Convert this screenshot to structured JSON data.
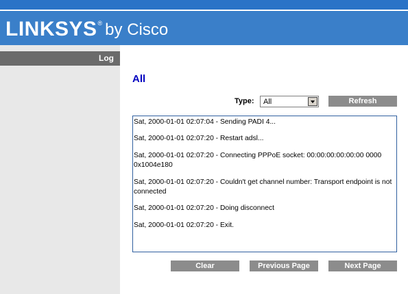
{
  "header": {
    "brand": "LINKSYS",
    "registered": "®",
    "suffix": "by Cisco"
  },
  "sidebar": {
    "active_tab": "Log"
  },
  "main": {
    "title": "All",
    "type_filter": {
      "label": "Type:",
      "selected": "All"
    },
    "refresh_label": "Refresh",
    "log_entries": [
      "Sat, 2000-01-01 02:07:04 - Sending PADI 4...",
      "Sat, 2000-01-01 02:07:20 - Restart adsl...",
      "Sat, 2000-01-01 02:07:20 - Connecting PPPoE socket: 00:00:00:00:00:00 0000 0x1004e180",
      "Sat, 2000-01-01 02:07:20 - Couldn't get channel number: Transport endpoint is not connected",
      "Sat, 2000-01-01 02:07:20 - Doing disconnect",
      "Sat, 2000-01-01 02:07:20 - Exit."
    ],
    "buttons": {
      "clear": "Clear",
      "previous_page": "Previous Page",
      "next_page": "Next Page"
    }
  },
  "colors": {
    "header_blue": "#3a7fc9",
    "title_blue": "#0000c0",
    "button_gray": "#8c8c8c",
    "sidebar_tab_gray": "#6b6b6b"
  }
}
